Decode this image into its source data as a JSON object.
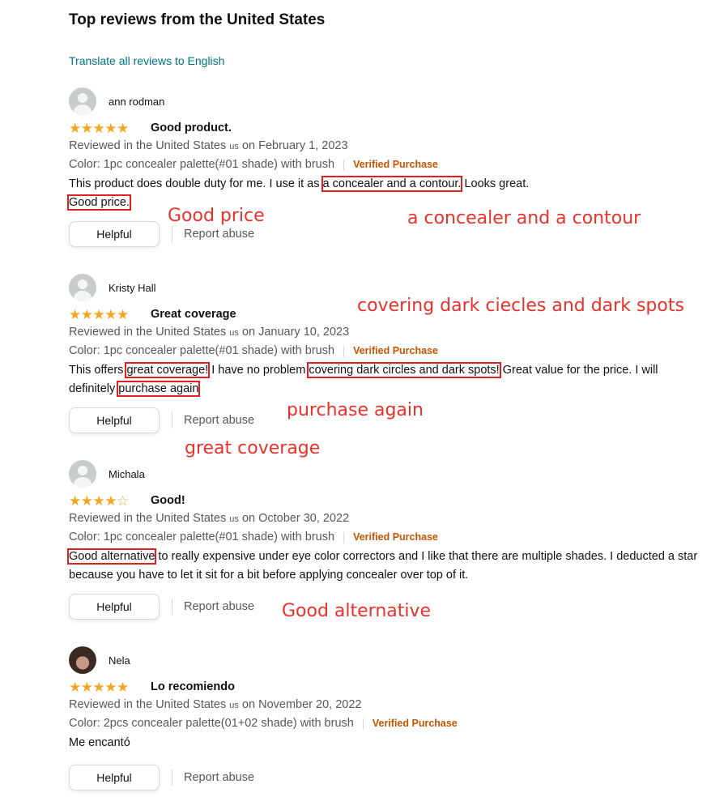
{
  "section_title": "Top reviews from the United States",
  "translate_link": "Translate all reviews to English",
  "actions": {
    "helpful_label": "Helpful",
    "report_label": "Report abuse"
  },
  "reviews": [
    {
      "name": "ann rodman",
      "rating": 5,
      "title": "Good product.",
      "reviewed_prefix": "Reviewed in the United States",
      "reviewed_us": "us",
      "reviewed_date": "on February 1, 2023",
      "color": "Color: 1pc concealer palette(#01 shade) with brush",
      "verified": "Verified Purchase",
      "body": {
        "p1": "This product does double duty for me. I use it as ",
        "h1": "a concealer and a contour.",
        "p2": " Looks great.",
        "h2": "Good price."
      }
    },
    {
      "name": "Kristy Hall",
      "rating": 5,
      "title": "Great coverage",
      "reviewed_prefix": "Reviewed in the United States",
      "reviewed_us": "us",
      "reviewed_date": "on January 10, 2023",
      "color": "Color: 1pc concealer palette(#01 shade) with brush",
      "verified": "Verified Purchase",
      "body": {
        "p1": "This offers ",
        "h1": "great coverage!",
        "p2": " I have no problem ",
        "h2": "covering dark circles and dark spots!",
        "p3": " Great value for the price. I will definitely ",
        "h3": "purchase again"
      }
    },
    {
      "name": "Michala",
      "rating": 4,
      "title": "Good!",
      "reviewed_prefix": "Reviewed in the United States",
      "reviewed_us": "us",
      "reviewed_date": "on October 30, 2022",
      "color": "Color: 1pc concealer palette(#01 shade) with brush",
      "verified": "Verified Purchase",
      "body": {
        "h1": "Good alternative",
        "p1": " to really expensive under eye color correctors and I like that there are multiple shades. I deducted a star because you have to let it sit for a bit before applying concealer over top of it."
      }
    },
    {
      "name": "Nela",
      "rating": 5,
      "title": "Lo recomiendo",
      "reviewed_prefix": "Reviewed in the United States",
      "reviewed_us": "us",
      "reviewed_date": "on November 20, 2022",
      "color": "Color: 2pcs concealer palette(01+02 shade) with brush",
      "verified": "Verified Purchase",
      "body": {
        "p1": "Me encantó"
      }
    }
  ],
  "annotations": {
    "good_price": "Good price",
    "concealer_contour": "a concealer and a contour",
    "covering": "covering dark ciecles and dark spots",
    "purchase_again": "purchase again",
    "great_coverage": "great coverage",
    "good_alternative": "Good alternative"
  },
  "colors": {
    "star": "#f5a623",
    "link": "#007185",
    "verified": "#c45500",
    "annotation": "#e8322b"
  }
}
